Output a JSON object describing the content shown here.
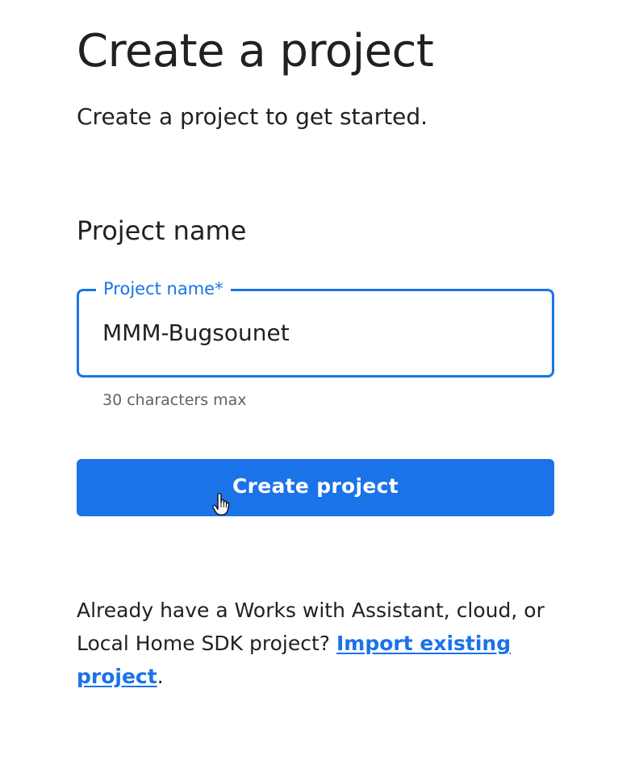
{
  "header": {
    "title": "Create a project",
    "subtitle": "Create a project to get started."
  },
  "form": {
    "section_heading": "Project name",
    "project_name": {
      "label": "Project name*",
      "value": "MMM-Bugsounet",
      "helper": "30 characters max"
    },
    "submit_label": "Create project"
  },
  "footer": {
    "text_before": "Already have a Works with Assistant, cloud, or Local Home SDK project? ",
    "link_label": "Import existing project",
    "text_after": "."
  },
  "icons": {
    "cursor": "hand-pointer-cursor-icon"
  },
  "colors": {
    "accent": "#1a73e8",
    "text": "#202124",
    "helper_text": "#5f6368",
    "background": "#ffffff"
  }
}
